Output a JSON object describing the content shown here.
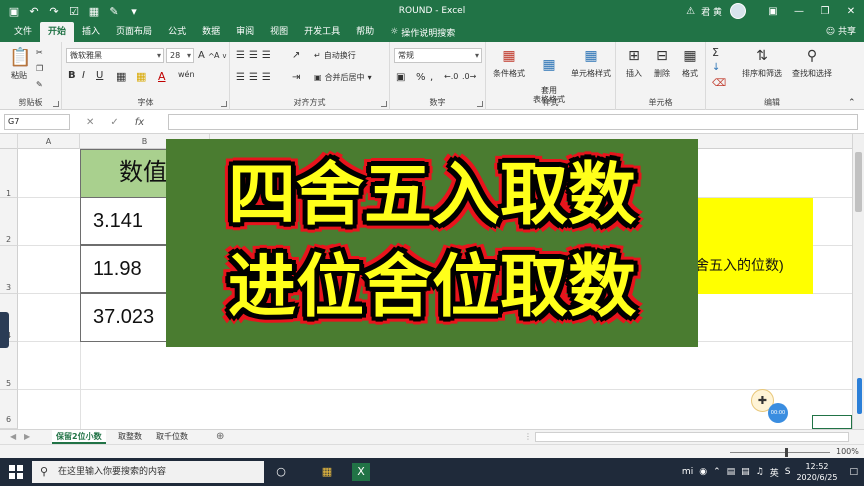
{
  "window": {
    "title": "ROUND  -  Excel",
    "user": "君 黄",
    "warning_icon": "warning-icon"
  },
  "tabs": [
    "文件",
    "开始",
    "插入",
    "页面布局",
    "公式",
    "数据",
    "审阅",
    "视图",
    "开发工具",
    "帮助"
  ],
  "tabs_active_index": 1,
  "search_hint": "操作说明搜索",
  "share_label": "共享",
  "ribbon": {
    "clipboard": {
      "paste": "粘贴",
      "label": "剪贴板"
    },
    "font": {
      "name": "微软雅黑",
      "size": "28",
      "grow": "A",
      "shrink": "A",
      "bold": "B",
      "italic": "I",
      "underline": "U",
      "label": "字体",
      "wen": "wén"
    },
    "alignment": {
      "wrap": "自动换行",
      "merge": "合并后居中",
      "label": "对齐方式"
    },
    "number": {
      "format": "常规",
      "percent": "%",
      "comma": ",",
      "label": "数字"
    },
    "styles": {
      "conditional": "条件格式",
      "table": "套用\n表格格式",
      "cell": "单元格样式",
      "label": "样式"
    },
    "cells": {
      "insert": "插入",
      "delete": "删除",
      "format": "格式",
      "label": "单元格"
    },
    "editing": {
      "sort": "排序和筛选",
      "find": "查找和选择",
      "label": "编辑"
    }
  },
  "formula_bar": {
    "name_box": "G7",
    "fx": "fx",
    "formula": ""
  },
  "grid": {
    "columns": [
      "A",
      "B"
    ],
    "rows": [
      "1",
      "2",
      "3",
      "4",
      "5",
      "6"
    ],
    "header_cell": "数值",
    "values": [
      "3.141",
      "11.98",
      "37.023"
    ],
    "note_text": "舍五入的位数)"
  },
  "overlay": {
    "line1": "四舍五入取数",
    "line2": "进位舍位取数"
  },
  "sheets": [
    "保留2位小数",
    "取整数",
    "取千位数"
  ],
  "sheets_active_index": 0,
  "status": {
    "zoom": "100%"
  },
  "taskbar": {
    "search_placeholder": "在这里输入你要搜索的内容",
    "ime": "英",
    "time": "12:52",
    "date": "2020/6/25"
  },
  "timer_text": "00:00",
  "colors": {
    "excel_green": "#217346",
    "overlay_bg": "#4a7c30",
    "overlay_text": "#ffff1a",
    "overlay_outline": "#e8141c",
    "header_fill": "#a9d08e",
    "highlight": "#ffff00"
  }
}
